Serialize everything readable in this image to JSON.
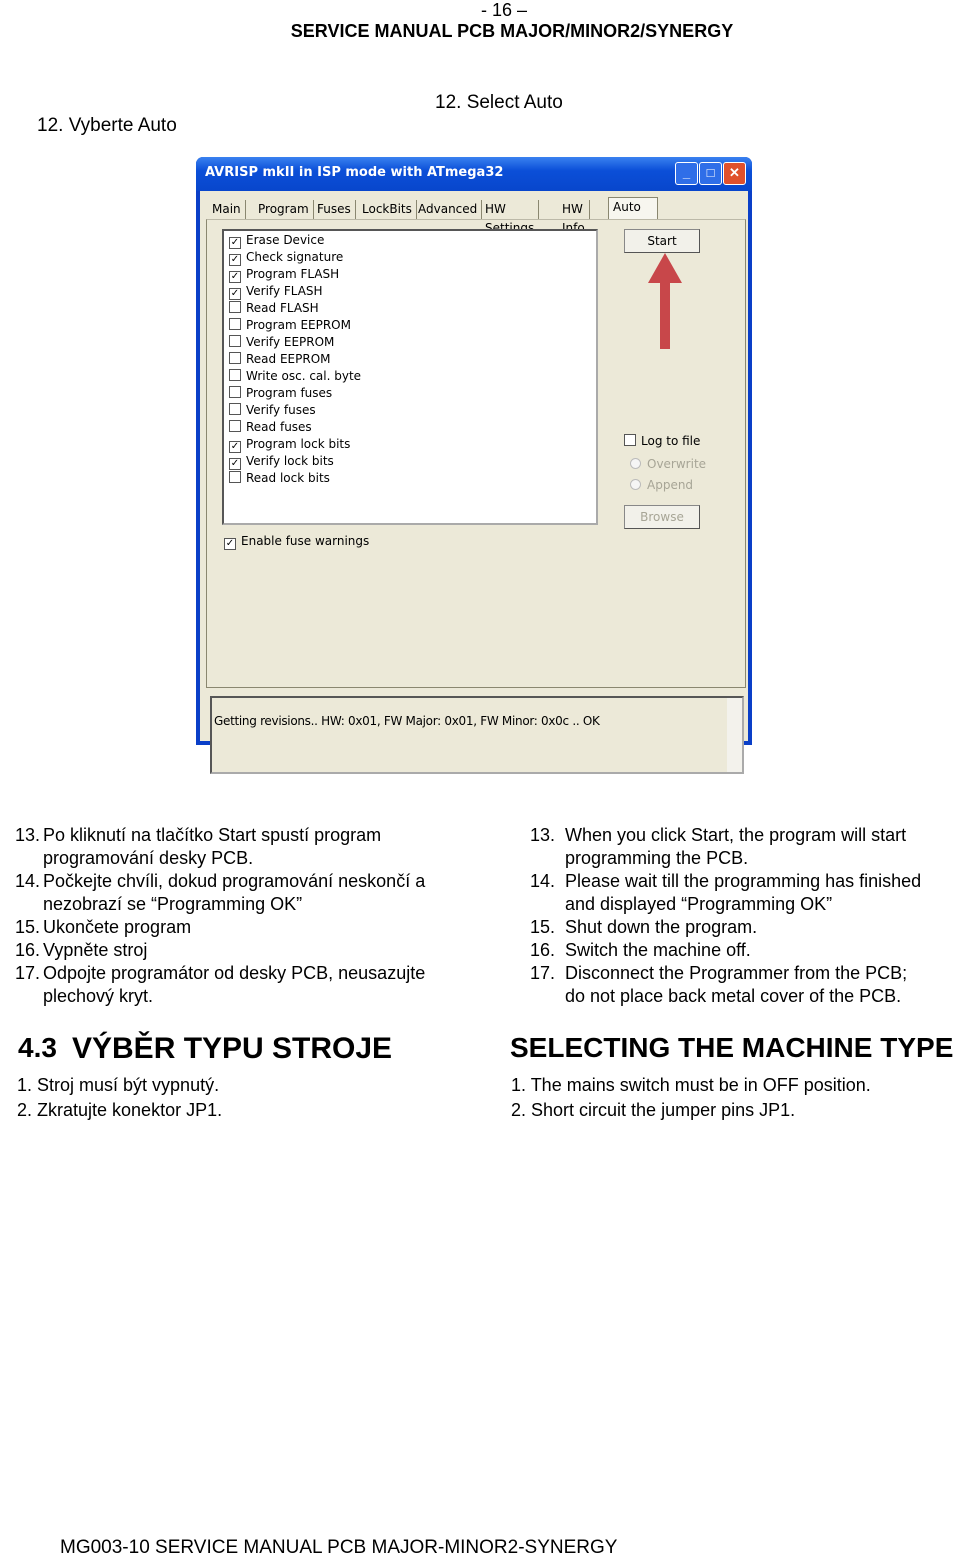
{
  "header": {
    "page_number": "- 16 –",
    "title": "SERVICE MANUAL PCB MAJOR/MINOR2/SYNERGY"
  },
  "step12": {
    "cz": "12. Vyberte Auto",
    "en": "12. Select Auto"
  },
  "window": {
    "title": "AVRISP mkII in ISP mode with ATmega32",
    "tabs": [
      "Main",
      "Program",
      "Fuses",
      "LockBits",
      "Advanced",
      "HW Settings",
      "HW Info",
      "Auto"
    ],
    "active_tab": "Auto",
    "options": [
      {
        "label": "Erase Device",
        "checked": true
      },
      {
        "label": "Check signature",
        "checked": true
      },
      {
        "label": "Program FLASH",
        "checked": true
      },
      {
        "label": "Verify FLASH",
        "checked": true
      },
      {
        "label": "Read FLASH",
        "checked": false
      },
      {
        "label": "Program EEPROM",
        "checked": false
      },
      {
        "label": "Verify EEPROM",
        "checked": false
      },
      {
        "label": "Read EEPROM",
        "checked": false
      },
      {
        "label": "Write osc. cal. byte",
        "checked": false
      },
      {
        "label": "Program fuses",
        "checked": false
      },
      {
        "label": "Verify fuses",
        "checked": false
      },
      {
        "label": "Read fuses",
        "checked": false
      },
      {
        "label": "Program lock bits",
        "checked": true
      },
      {
        "label": "Verify lock bits",
        "checked": true
      },
      {
        "label": "Read lock bits",
        "checked": false
      }
    ],
    "start_label": "Start",
    "log_to_file": "Log to file",
    "overwrite": "Overwrite",
    "append": "Append",
    "browse": "Browse",
    "fuse_warnings": "Enable fuse warnings",
    "log_text": "Getting revisions.. HW: 0x01, FW Major: 0x01, FW Minor: 0x0c .. OK",
    "arrow_color": "#c8474a"
  },
  "steps_cz": [
    {
      "num": "13.",
      "text": "Po kliknutí na tlačítko Start spustí program",
      "cont": "programování desky PCB."
    },
    {
      "num": "14.",
      "text": "Počkejte chvíli, dokud programování neskončí a",
      "cont": "nezobrazí se “Programming OK”"
    },
    {
      "num": "15.",
      "text": "Ukončete program",
      "cont": ""
    },
    {
      "num": "16.",
      "text": "Vypněte stroj",
      "cont": ""
    },
    {
      "num": "17.",
      "text": "Odpojte programátor od desky PCB, neusazujte",
      "cont": "plechový kryt."
    }
  ],
  "steps_en": [
    {
      "num": "13.",
      "text": "When you click Start, the program will start",
      "cont": "programming the PCB."
    },
    {
      "num": "14.",
      "text": "Please wait till the programming has finished",
      "cont": "and displayed “Programming OK”"
    },
    {
      "num": "15.",
      "text": "Shut down the program.",
      "cont": ""
    },
    {
      "num": "16.",
      "text": "Switch the machine off.",
      "cont": ""
    },
    {
      "num": "17.",
      "text": "Disconnect the Programmer from the PCB;",
      "cont": "do not place back metal cover of the PCB."
    }
  ],
  "section": {
    "number": "4.3",
    "title_cz": "VÝBĚR TYPU STROJE",
    "title_en": "SELECTING THE MACHINE TYPE",
    "items_cz": [
      "1.  Stroj musí být vypnutý.",
      "2.  Zkratujte konektor JP1."
    ],
    "items_en": [
      "1.  The mains switch must be in OFF position.",
      "2.  Short circuit the jumper pins JP1."
    ]
  },
  "footer": "MG003-10 SERVICE MANUAL PCB MAJOR-MINOR2-SYNERGY"
}
